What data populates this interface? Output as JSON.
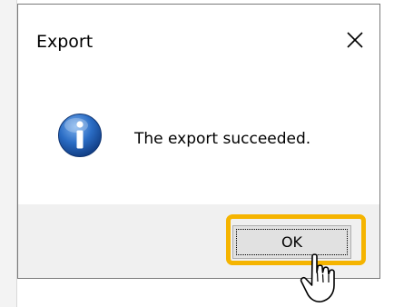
{
  "dialog": {
    "title": "Export",
    "message": "The export succeeded.",
    "ok_label": "OK"
  },
  "icons": {
    "close": "close-icon",
    "info": "info-icon",
    "cursor": "hand-pointer-icon"
  },
  "colors": {
    "highlight": "#f5b400",
    "info_blue": "#1f5ea8",
    "footer_bg": "#f0f0f0",
    "button_bg": "#e1e1e1"
  }
}
